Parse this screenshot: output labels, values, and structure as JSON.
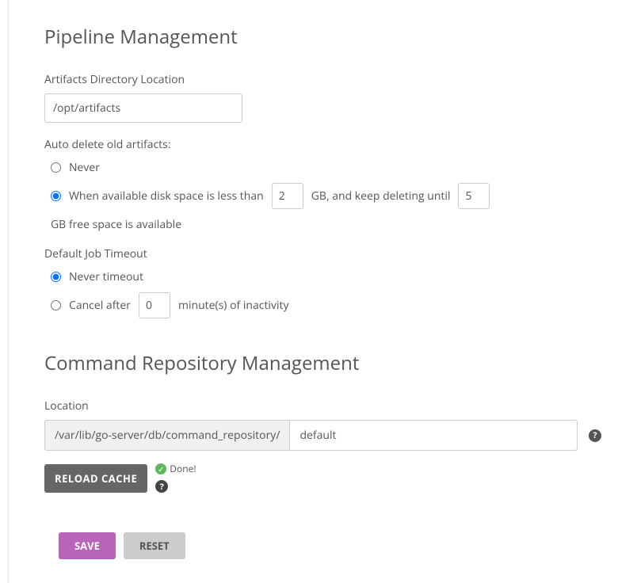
{
  "pipeline": {
    "heading": "Pipeline Management",
    "artifacts_dir_label": "Artifacts Directory Location",
    "artifacts_dir_value": "/opt/artifacts",
    "auto_delete_label": "Auto delete old artifacts:",
    "auto_delete_never": "Never",
    "auto_delete_when_prefix": "When available disk space is less than",
    "auto_delete_threshold": "2",
    "auto_delete_gb_mid": "GB, and keep deleting until",
    "auto_delete_keep_until": "5",
    "auto_delete_gb_suffix": "GB free space is available",
    "timeout_label": "Default Job Timeout",
    "timeout_never": "Never timeout",
    "timeout_cancel_prefix": "Cancel after",
    "timeout_minutes": "0",
    "timeout_cancel_suffix": "minute(s) of inactivity"
  },
  "cmdrepo": {
    "heading": "Command Repository Management",
    "location_label": "Location",
    "location_prefix": "/var/lib/go-server/db/command_repository/",
    "location_value": "default",
    "reload_label": "RELOAD CACHE",
    "done_label": "Done!"
  },
  "buttons": {
    "save": "SAVE",
    "reset": "RESET"
  }
}
